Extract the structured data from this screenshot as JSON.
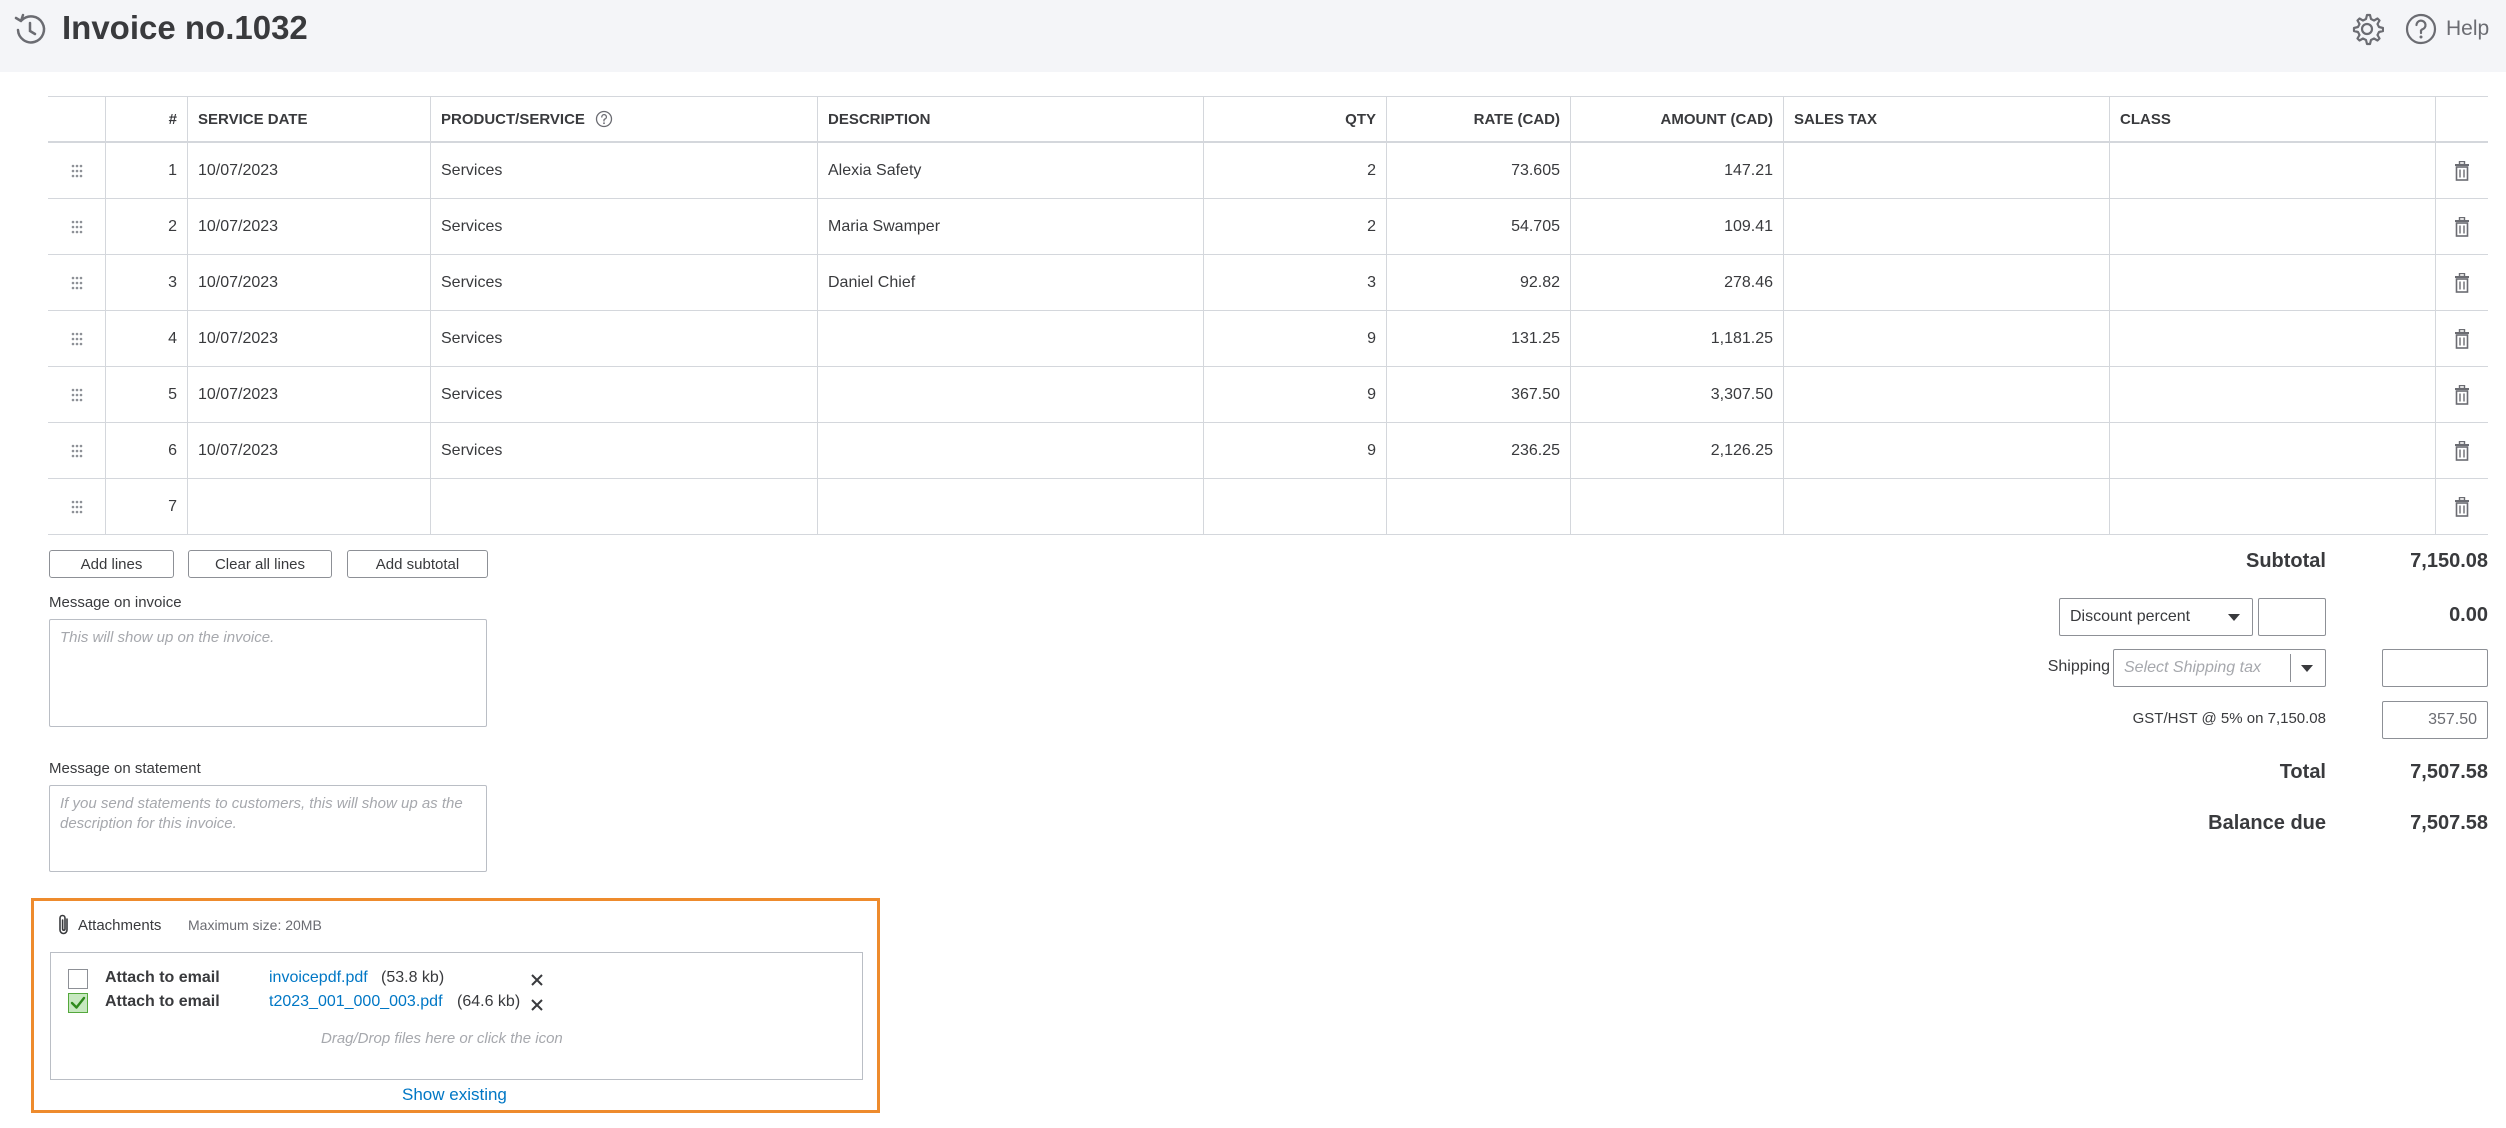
{
  "header": {
    "title": "Invoice no.1032",
    "help_label": "Help"
  },
  "table": {
    "columns": {
      "num": "#",
      "service_date": "SERVICE DATE",
      "product": "PRODUCT/SERVICE",
      "description": "DESCRIPTION",
      "qty": "QTY",
      "rate": "RATE (CAD)",
      "amount": "AMOUNT (CAD)",
      "sales_tax": "SALES TAX",
      "class": "CLASS"
    },
    "rows": [
      {
        "num": "1",
        "date": "10/07/2023",
        "product": "Services",
        "description": "Alexia Safety",
        "qty": "2",
        "rate": "73.605",
        "amount": "147.21"
      },
      {
        "num": "2",
        "date": "10/07/2023",
        "product": "Services",
        "description": "Maria Swamper",
        "qty": "2",
        "rate": "54.705",
        "amount": "109.41"
      },
      {
        "num": "3",
        "date": "10/07/2023",
        "product": "Services",
        "description": "Daniel Chief",
        "qty": "3",
        "rate": "92.82",
        "amount": "278.46"
      },
      {
        "num": "4",
        "date": "10/07/2023",
        "product": "Services",
        "description": "",
        "qty": "9",
        "rate": "131.25",
        "amount": "1,181.25"
      },
      {
        "num": "5",
        "date": "10/07/2023",
        "product": "Services",
        "description": "",
        "qty": "9",
        "rate": "367.50",
        "amount": "3,307.50"
      },
      {
        "num": "6",
        "date": "10/07/2023",
        "product": "Services",
        "description": "",
        "qty": "9",
        "rate": "236.25",
        "amount": "2,126.25"
      },
      {
        "num": "7",
        "date": "",
        "product": "",
        "description": "",
        "qty": "",
        "rate": "",
        "amount": ""
      }
    ]
  },
  "actions": {
    "add_lines": "Add lines",
    "clear_all_lines": "Clear all lines",
    "add_subtotal": "Add subtotal"
  },
  "messages": {
    "invoice_label": "Message on invoice",
    "invoice_placeholder": "This will show up on the invoice.",
    "statement_label": "Message on statement",
    "statement_placeholder": "If you send statements to customers, this will show up as the description for this invoice."
  },
  "totals": {
    "subtotal_label": "Subtotal",
    "subtotal_value": "7,150.08",
    "discount_select": "Discount percent",
    "discount_input": "",
    "discount_value": "0.00",
    "shipping_label": "Shipping",
    "shipping_placeholder": "Select Shipping tax",
    "shipping_input": "",
    "gst_label": "GST/HST @ 5% on 7,150.08",
    "gst_value": "357.50",
    "total_label": "Total",
    "total_value": "7,507.58",
    "balance_label": "Balance due",
    "balance_value": "7,507.58"
  },
  "attachments": {
    "title": "Attachments",
    "max_size": "Maximum size: 20MB",
    "files": [
      {
        "attach_label": "Attach to email",
        "name": "invoicepdf.pdf",
        "size": "(53.8 kb)",
        "checked": false
      },
      {
        "attach_label": "Attach to email",
        "name": "t2023_001_000_003.pdf",
        "size": "(64.6 kb)",
        "checked": true
      }
    ],
    "drop_hint": "Drag/Drop files here or click the icon",
    "show_existing": "Show existing"
  },
  "colors": {
    "attachments_border": "#ee8b2d",
    "link": "#0077c5",
    "checkbox_checked": "#54a83c"
  }
}
